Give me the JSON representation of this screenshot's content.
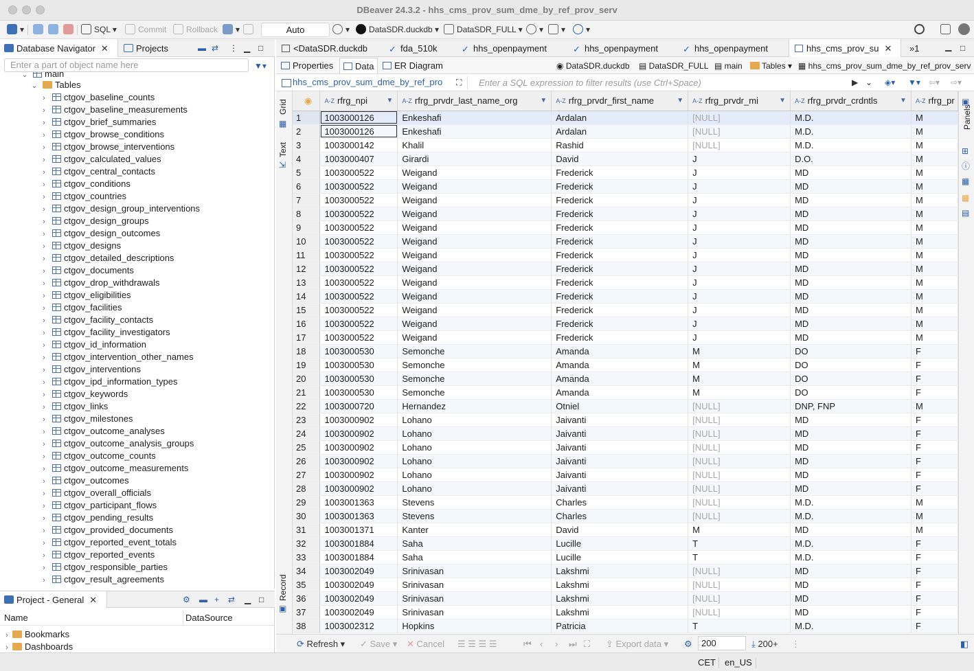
{
  "window": {
    "title": "DBeaver 24.3.2 - hhs_cms_prov_sum_dme_by_ref_prov_serv"
  },
  "toolbar": {
    "sql_label": "SQL",
    "commit_label": "Commit",
    "rollback_label": "Rollback",
    "transaction_mode": "Auto",
    "datasource": "DataSDR.duckdb",
    "schema": "DataSDR_FULL"
  },
  "navigator": {
    "tab_label": "Database Navigator",
    "projects_tab_label": "Projects",
    "filter_placeholder": "Enter a part of object name here",
    "schema_node": "main",
    "tables_node": "Tables",
    "tables": [
      "ctgov_baseline_counts",
      "ctgov_baseline_measurements",
      "ctgov_brief_summaries",
      "ctgov_browse_conditions",
      "ctgov_browse_interventions",
      "ctgov_calculated_values",
      "ctgov_central_contacts",
      "ctgov_conditions",
      "ctgov_countries",
      "ctgov_design_group_interventions",
      "ctgov_design_groups",
      "ctgov_design_outcomes",
      "ctgov_designs",
      "ctgov_detailed_descriptions",
      "ctgov_documents",
      "ctgov_drop_withdrawals",
      "ctgov_eligibilities",
      "ctgov_facilities",
      "ctgov_facility_contacts",
      "ctgov_facility_investigators",
      "ctgov_id_information",
      "ctgov_intervention_other_names",
      "ctgov_interventions",
      "ctgov_ipd_information_types",
      "ctgov_keywords",
      "ctgov_links",
      "ctgov_milestones",
      "ctgov_outcome_analyses",
      "ctgov_outcome_analysis_groups",
      "ctgov_outcome_counts",
      "ctgov_outcome_measurements",
      "ctgov_outcomes",
      "ctgov_overall_officials",
      "ctgov_participant_flows",
      "ctgov_pending_results",
      "ctgov_provided_documents",
      "ctgov_reported_event_totals",
      "ctgov_reported_events",
      "ctgov_responsible_parties",
      "ctgov_result_agreements"
    ]
  },
  "project": {
    "tab_label": "Project - General",
    "col_name": "Name",
    "col_datasource": "DataSource",
    "items": [
      "Bookmarks",
      "Dashboards"
    ]
  },
  "editor_tabs": [
    "<DataSDR.duckdb",
    "fda_510k",
    "hhs_openpayment",
    "hhs_openpayment",
    "hhs_openpayment",
    "hhs_cms_prov_su"
  ],
  "overflow_tabs": "1",
  "subtabs": {
    "properties": "Properties",
    "data": "Data",
    "er": "ER Diagram"
  },
  "breadcrumb": {
    "datasource": "DataSDR.duckdb",
    "schema": "DataSDR_FULL",
    "catalog": "main",
    "folder": "Tables",
    "table": "hhs_cms_prov_sum_dme_by_ref_prov_serv"
  },
  "filter": {
    "table_label": "hhs_cms_prov_sum_dme_by_ref_pro",
    "placeholder": "Enter a SQL expression to filter results (use Ctrl+Space)"
  },
  "side_tabs": {
    "grid": "Grid",
    "text": "Text",
    "record": "Record",
    "panels": "Panels"
  },
  "grid": {
    "type_badge": "A-Z",
    "columns": [
      "rfrg_npi",
      "rfrg_prvdr_last_name_org",
      "rfrg_prvdr_first_name",
      "rfrg_prvdr_mi",
      "rfrg_prvdr_crdntls",
      "rfrg_pr"
    ],
    "rows": [
      [
        "1",
        "1003000126",
        "Enkeshafi",
        "Ardalan",
        "[NULL]",
        "M.D.",
        "M"
      ],
      [
        "2",
        "1003000126",
        "Enkeshafi",
        "Ardalan",
        "[NULL]",
        "M.D.",
        "M"
      ],
      [
        "3",
        "1003000142",
        "Khalil",
        "Rashid",
        "[NULL]",
        "M.D.",
        "M"
      ],
      [
        "4",
        "1003000407",
        "Girardi",
        "David",
        "J",
        "D.O.",
        "M"
      ],
      [
        "5",
        "1003000522",
        "Weigand",
        "Frederick",
        "J",
        "MD",
        "M"
      ],
      [
        "6",
        "1003000522",
        "Weigand",
        "Frederick",
        "J",
        "MD",
        "M"
      ],
      [
        "7",
        "1003000522",
        "Weigand",
        "Frederick",
        "J",
        "MD",
        "M"
      ],
      [
        "8",
        "1003000522",
        "Weigand",
        "Frederick",
        "J",
        "MD",
        "M"
      ],
      [
        "9",
        "1003000522",
        "Weigand",
        "Frederick",
        "J",
        "MD",
        "M"
      ],
      [
        "10",
        "1003000522",
        "Weigand",
        "Frederick",
        "J",
        "MD",
        "M"
      ],
      [
        "11",
        "1003000522",
        "Weigand",
        "Frederick",
        "J",
        "MD",
        "M"
      ],
      [
        "12",
        "1003000522",
        "Weigand",
        "Frederick",
        "J",
        "MD",
        "M"
      ],
      [
        "13",
        "1003000522",
        "Weigand",
        "Frederick",
        "J",
        "MD",
        "M"
      ],
      [
        "14",
        "1003000522",
        "Weigand",
        "Frederick",
        "J",
        "MD",
        "M"
      ],
      [
        "15",
        "1003000522",
        "Weigand",
        "Frederick",
        "J",
        "MD",
        "M"
      ],
      [
        "16",
        "1003000522",
        "Weigand",
        "Frederick",
        "J",
        "MD",
        "M"
      ],
      [
        "17",
        "1003000522",
        "Weigand",
        "Frederick",
        "J",
        "MD",
        "M"
      ],
      [
        "18",
        "1003000530",
        "Semonche",
        "Amanda",
        "M",
        "DO",
        "F"
      ],
      [
        "19",
        "1003000530",
        "Semonche",
        "Amanda",
        "M",
        "DO",
        "F"
      ],
      [
        "20",
        "1003000530",
        "Semonche",
        "Amanda",
        "M",
        "DO",
        "F"
      ],
      [
        "21",
        "1003000530",
        "Semonche",
        "Amanda",
        "M",
        "DO",
        "F"
      ],
      [
        "22",
        "1003000720",
        "Hernandez",
        "Otniel",
        "[NULL]",
        "DNP, FNP",
        "M"
      ],
      [
        "23",
        "1003000902",
        "Lohano",
        "Jaivanti",
        "[NULL]",
        "MD",
        "F"
      ],
      [
        "24",
        "1003000902",
        "Lohano",
        "Jaivanti",
        "[NULL]",
        "MD",
        "F"
      ],
      [
        "25",
        "1003000902",
        "Lohano",
        "Jaivanti",
        "[NULL]",
        "MD",
        "F"
      ],
      [
        "26",
        "1003000902",
        "Lohano",
        "Jaivanti",
        "[NULL]",
        "MD",
        "F"
      ],
      [
        "27",
        "1003000902",
        "Lohano",
        "Jaivanti",
        "[NULL]",
        "MD",
        "F"
      ],
      [
        "28",
        "1003000902",
        "Lohano",
        "Jaivanti",
        "[NULL]",
        "MD",
        "F"
      ],
      [
        "29",
        "1003001363",
        "Stevens",
        "Charles",
        "[NULL]",
        "M.D.",
        "M"
      ],
      [
        "30",
        "1003001363",
        "Stevens",
        "Charles",
        "[NULL]",
        "M.D.",
        "M"
      ],
      [
        "31",
        "1003001371",
        "Kanter",
        "David",
        "M",
        "MD",
        "M"
      ],
      [
        "32",
        "1003001884",
        "Saha",
        "Lucille",
        "T",
        "M.D.",
        "F"
      ],
      [
        "33",
        "1003001884",
        "Saha",
        "Lucille",
        "T",
        "M.D.",
        "F"
      ],
      [
        "34",
        "1003002049",
        "Srinivasan",
        "Lakshmi",
        "[NULL]",
        "MD",
        "F"
      ],
      [
        "35",
        "1003002049",
        "Srinivasan",
        "Lakshmi",
        "[NULL]",
        "MD",
        "F"
      ],
      [
        "36",
        "1003002049",
        "Srinivasan",
        "Lakshmi",
        "[NULL]",
        "MD",
        "F"
      ],
      [
        "37",
        "1003002049",
        "Srinivasan",
        "Lakshmi",
        "[NULL]",
        "MD",
        "F"
      ],
      [
        "38",
        "1003002312",
        "Hopkins",
        "Patricia",
        "T",
        "M.D.",
        "F"
      ]
    ]
  },
  "bottom_toolbar": {
    "refresh": "Refresh",
    "save": "Save",
    "cancel": "Cancel",
    "export": "Export data",
    "fetch_size": "200",
    "row_count": "200+"
  },
  "status": {
    "timezone": "CET",
    "locale": "en_US"
  },
  "colors": {
    "accent": "#2e5fa8",
    "null_text": "#a8a8a8",
    "selection": "#e3ecf8"
  }
}
